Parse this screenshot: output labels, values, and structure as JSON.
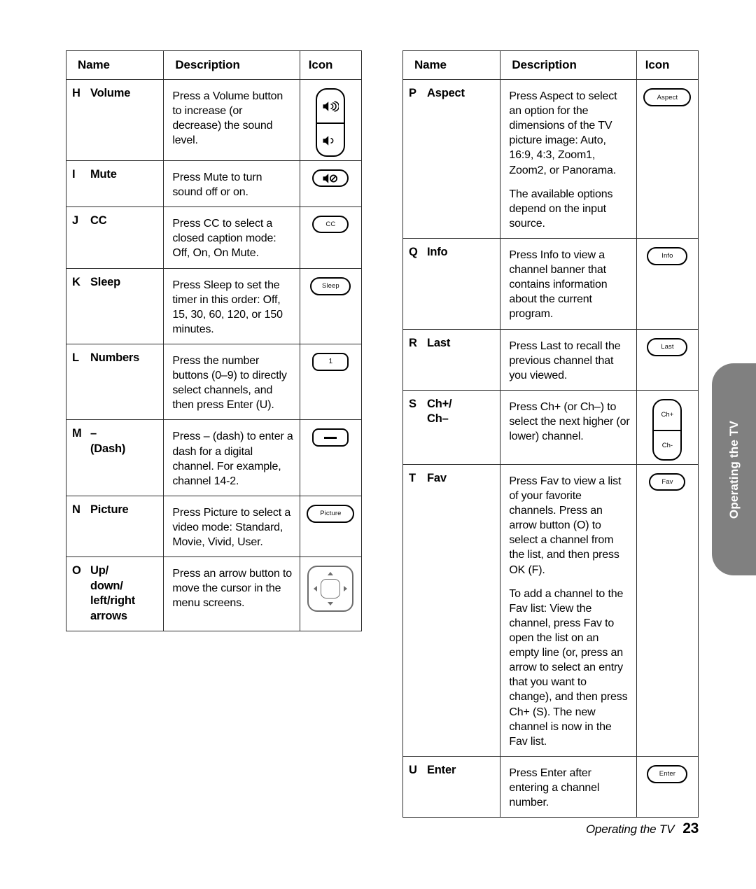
{
  "page": {
    "footer_section": "Operating the TV",
    "footer_page_number": "23",
    "side_tab_label": "Operating the TV",
    "side_tab_color": "#808080"
  },
  "columns": {
    "name": "Name",
    "description": "Description",
    "icon": "Icon"
  },
  "left_table": [
    {
      "letter": "H",
      "name": "Volume",
      "description": [
        "Press a Volume button to increase (or decrease) the sound level."
      ],
      "icon": {
        "type": "volume-rocker-icon",
        "top": "volume-up-icon",
        "bottom": "volume-down-icon"
      }
    },
    {
      "letter": "I",
      "name": "Mute",
      "description": [
        "Press Mute to turn sound off or on."
      ],
      "icon": {
        "type": "mute-icon",
        "label": ""
      }
    },
    {
      "letter": "J",
      "name": "CC",
      "description": [
        "Press CC to select a closed caption mode: Off, On, On Mute."
      ],
      "icon": {
        "type": "button-pill",
        "label": "CC"
      }
    },
    {
      "letter": "K",
      "name": "Sleep",
      "description": [
        "Press Sleep to set the timer in this order: Off, 15, 30, 60, 120, or 150 minutes."
      ],
      "icon": {
        "type": "button-pill",
        "label": "Sleep"
      }
    },
    {
      "letter": "L",
      "name": "Numbers",
      "description": [
        "Press the number buttons (0–9) to directly select channels, and then press Enter (U)."
      ],
      "icon": {
        "type": "button-rounded",
        "label": "1"
      }
    },
    {
      "letter": "M",
      "name": "– (Dash)",
      "description": [
        "Press – (dash) to enter a dash for a digital channel. For example, channel 14-2."
      ],
      "icon": {
        "type": "dash-button",
        "label": "—"
      }
    },
    {
      "letter": "N",
      "name": "Picture",
      "description": [
        "Press Picture to select a video mode: Standard, Movie, Vivid, User."
      ],
      "icon": {
        "type": "button-pill",
        "label": "Picture"
      }
    },
    {
      "letter": "O",
      "name": "Up/ down/ left/right arrows",
      "description": [
        "Press an arrow button to move the cursor in the menu screens."
      ],
      "icon": {
        "type": "dpad-icon",
        "label": ""
      }
    }
  ],
  "right_table": [
    {
      "letter": "P",
      "name": "Aspect",
      "description": [
        "Press Aspect to select an option for the dimensions of the TV picture image: Auto, 16:9, 4:3, Zoom1, Zoom2, or Panorama.",
        "The available options depend on the input source."
      ],
      "icon": {
        "type": "button-pill",
        "label": "Aspect"
      }
    },
    {
      "letter": "Q",
      "name": "Info",
      "description": [
        "Press Info to view a channel banner that contains information about the current program."
      ],
      "icon": {
        "type": "button-pill",
        "label": "Info"
      }
    },
    {
      "letter": "R",
      "name": "Last",
      "description": [
        "Press Last to recall the previous channel that you viewed."
      ],
      "icon": {
        "type": "button-pill",
        "label": "Last"
      }
    },
    {
      "letter": "S",
      "name": "Ch+/ Ch–",
      "description": [
        "Press Ch+ (or Ch–) to select the next higher (or lower) channel."
      ],
      "icon": {
        "type": "channel-rocker-icon",
        "top": "Ch+",
        "bottom": "Ch-"
      }
    },
    {
      "letter": "T",
      "name": "Fav",
      "description": [
        "Press Fav to view a list of your favorite channels. Press an arrow button (O) to select a channel from the list, and then press OK (F).",
        "To add a channel to the Fav list: View the channel, press Fav to open the list on an empty line (or, press an arrow to select an entry that you want to change), and then press Ch+ (S). The new channel is now in the Fav list."
      ],
      "icon": {
        "type": "button-pill",
        "label": "Fav"
      }
    },
    {
      "letter": "U",
      "name": "Enter",
      "description": [
        "Press Enter after entering a channel number."
      ],
      "icon": {
        "type": "button-pill",
        "label": "Enter"
      }
    }
  ]
}
